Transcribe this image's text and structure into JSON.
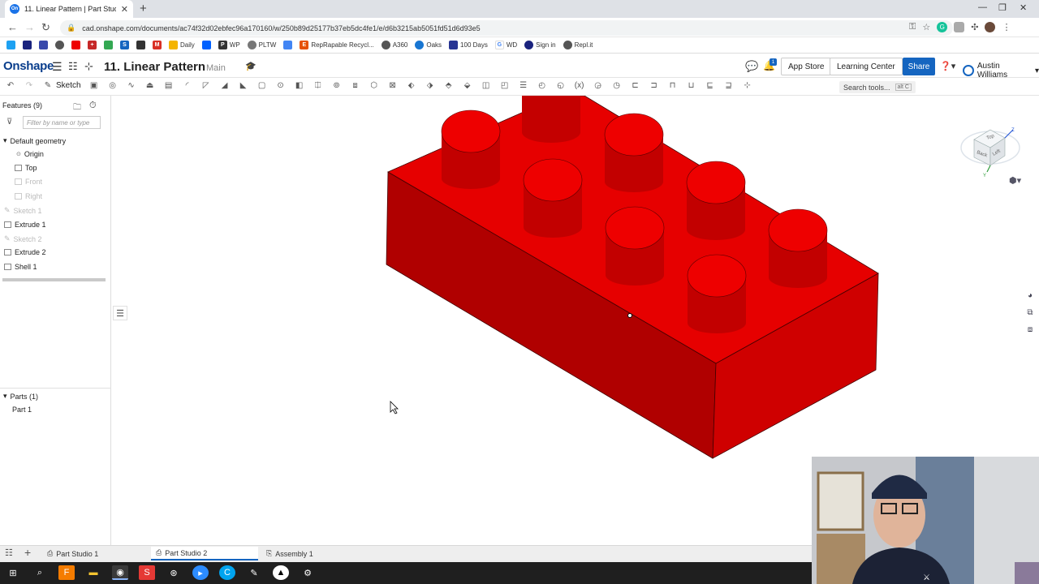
{
  "browser": {
    "tab_title": "11. Linear Pattern | Part Studio 2",
    "favicon_text": "On",
    "url": "cad.onshape.com/documents/ac74f32d02ebfec96a170160/w/250b89d25177b37eb5dc4fe1/e/d6b3215ab5051fd51d6d93e5",
    "bookmarks": [
      "Daily",
      "WP",
      "PLTW",
      "RepRapable Recycl...",
      "A360",
      "Oaks",
      "100 Days",
      "WD",
      "Sign in",
      "Repl.it"
    ]
  },
  "onshape": {
    "logo": "Onshape",
    "doc_title": "11. Linear Pattern",
    "branch": "Main",
    "notification_count": "1",
    "app_store": "App Store",
    "learning_center": "Learning Center",
    "share": "Share",
    "user": "Austin Williams"
  },
  "toolbar": {
    "sketch_label": "Sketch",
    "search_placeholder": "Search tools...",
    "search_shortcut": "alt C"
  },
  "feature_tree": {
    "header": "Features (9)",
    "filter_placeholder": "Filter by name or type",
    "default_geometry": "Default geometry",
    "items": [
      {
        "label": "Origin"
      },
      {
        "label": "Top"
      },
      {
        "label": "Front"
      },
      {
        "label": "Right"
      },
      {
        "label": "Sketch 1"
      },
      {
        "label": "Extrude 1"
      },
      {
        "label": "Sketch 2"
      },
      {
        "label": "Extrude 2"
      },
      {
        "label": "Shell 1"
      }
    ],
    "parts_header": "Parts (1)",
    "parts": [
      "Part 1"
    ]
  },
  "viewcube": {
    "top": "Top",
    "front": "Back",
    "left": "Left",
    "z": "Z",
    "y": "Y"
  },
  "bottom_tabs": [
    "Part Studio 1",
    "Part Studio 2",
    "Assembly 1"
  ],
  "colors": {
    "onshape_blue": "#1565c0",
    "part_top": "#e60000",
    "part_front": "#b00000",
    "part_right": "#cc0000"
  }
}
